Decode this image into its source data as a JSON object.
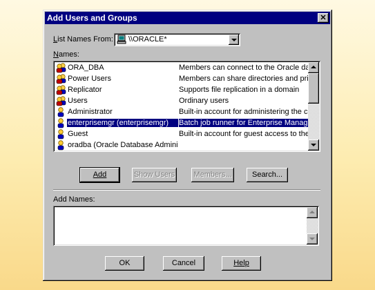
{
  "dialog": {
    "title": "Add Users and Groups",
    "close_glyph": "✕",
    "list_names_from_label": "List Names From:",
    "list_names_from_value": "\\\\ORACLE*",
    "names_label": "Names:",
    "names": [
      {
        "name": "ORA_DBA",
        "description": "Members can connect to the Oracle database",
        "icon": "group-icon",
        "selected": false
      },
      {
        "name": "Power Users",
        "description": "Members can share directories and printers",
        "icon": "group-icon",
        "selected": false
      },
      {
        "name": "Replicator",
        "description": "Supports file replication in a domain",
        "icon": "group-icon",
        "selected": false
      },
      {
        "name": "Users",
        "description": "Ordinary users",
        "icon": "group-icon",
        "selected": false
      },
      {
        "name": "Administrator",
        "description": "Built-in account for administering the computer",
        "icon": "user-icon",
        "selected": false
      },
      {
        "name": "enterprisemgr (enterprisemgr)",
        "description": "Batch job runner for Enterprise Manager",
        "icon": "user-icon",
        "selected": true
      },
      {
        "name": "Guest",
        "description": "Built-in account for guest access to the computer",
        "icon": "user-icon",
        "selected": false
      },
      {
        "name": "oradba (Oracle Database Administrator)",
        "description": "",
        "icon": "user-icon",
        "selected": false
      }
    ],
    "buttons": {
      "add": "Add",
      "show_users": "Show Users",
      "members": "Members...",
      "search": "Search...",
      "ok": "OK",
      "cancel": "Cancel",
      "help": "Help"
    },
    "add_names_label": "Add Names:",
    "add_names_value": ""
  },
  "colors": {
    "titlebar": "#000080",
    "dialog_face": "#c0c0c0",
    "selection": "#000080",
    "background_top": "#fff9e2",
    "background_bottom": "#f9d98a"
  }
}
